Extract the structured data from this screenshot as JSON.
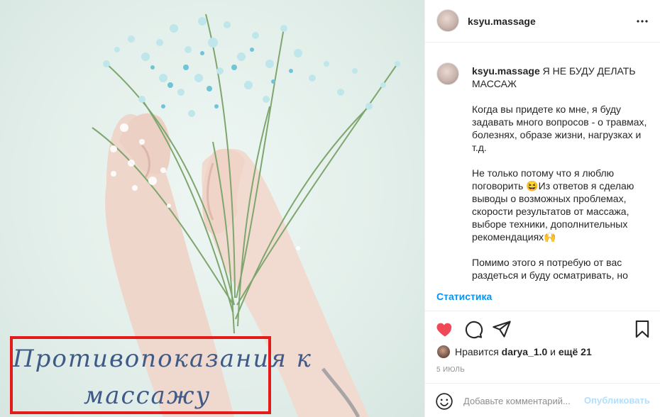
{
  "post": {
    "image": {
      "caption_line1": "Противопоказания  к",
      "caption_line2": "массажу",
      "caption_color": "#3f5a86",
      "frame_color": "#e31b1b"
    },
    "author": {
      "username": "ksyu.massage"
    },
    "comment": {
      "username": "ksyu.massage",
      "title": "Я НЕ БУДУ ДЕЛАТЬ МАССАЖ",
      "paragraph1": "Когда вы придете ко мне, я буду задавать много вопросов - о травмах, болезнях, образе жизни, нагрузках и т.д.",
      "paragraph2_a": "Не только потому что я люблю поговорить ",
      "paragraph2_emoji": "😆",
      "paragraph2_b": "Из ответов я сделаю выводы о возможных проблемах, скорости результатов от массажа, выборе техники, дополнительных рекомендациях",
      "paragraph2_emoji2": "🙌",
      "paragraph3": "Помимо этого я потребую от вас раздеться и буду осматривать, но"
    },
    "stats_link": "Статистика",
    "likes": {
      "prefix": "Нравится",
      "user": "darya_1.0",
      "connector": "и",
      "others": "ещё 21"
    },
    "date": "5 ИЮЛЬ",
    "add_comment": {
      "placeholder": "Добавьте комментарий...",
      "publish_label": "Опубликовать"
    },
    "colors": {
      "heart": "#ed4956",
      "link": "#0095f6",
      "publish_disabled": "#b2dffc"
    }
  }
}
